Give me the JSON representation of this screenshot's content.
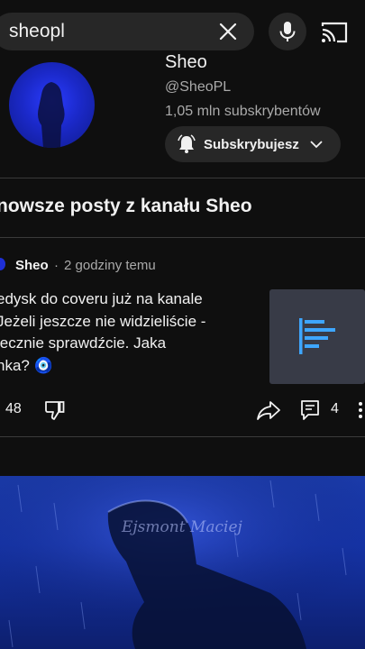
{
  "search": {
    "query": "sheopl"
  },
  "channel": {
    "name": "Sheo",
    "handle": "@SheoPL",
    "subscribers": "1,05 mln subskrybentów",
    "subscribe_label": "Subskrybujesz"
  },
  "posts_section": {
    "heading": "nowsze posty z kanału Sheo"
  },
  "post": {
    "author": "Sheo",
    "separator": "·",
    "time": "2 godziny temu",
    "text": "edysk do coveru już na kanale\nJeżeli jeszcze nie widzieliście -\niecznie sprawdźcie. Jaka\nnka? 🧿",
    "likes": "48",
    "comments": "4"
  },
  "video": {
    "watermark": "Ejsmont Maciej"
  },
  "colors": {
    "background": "#0f0f0f",
    "pill": "#272727",
    "secondary_text": "#aaaaaa",
    "avatar_blue": "#1b29c9"
  }
}
